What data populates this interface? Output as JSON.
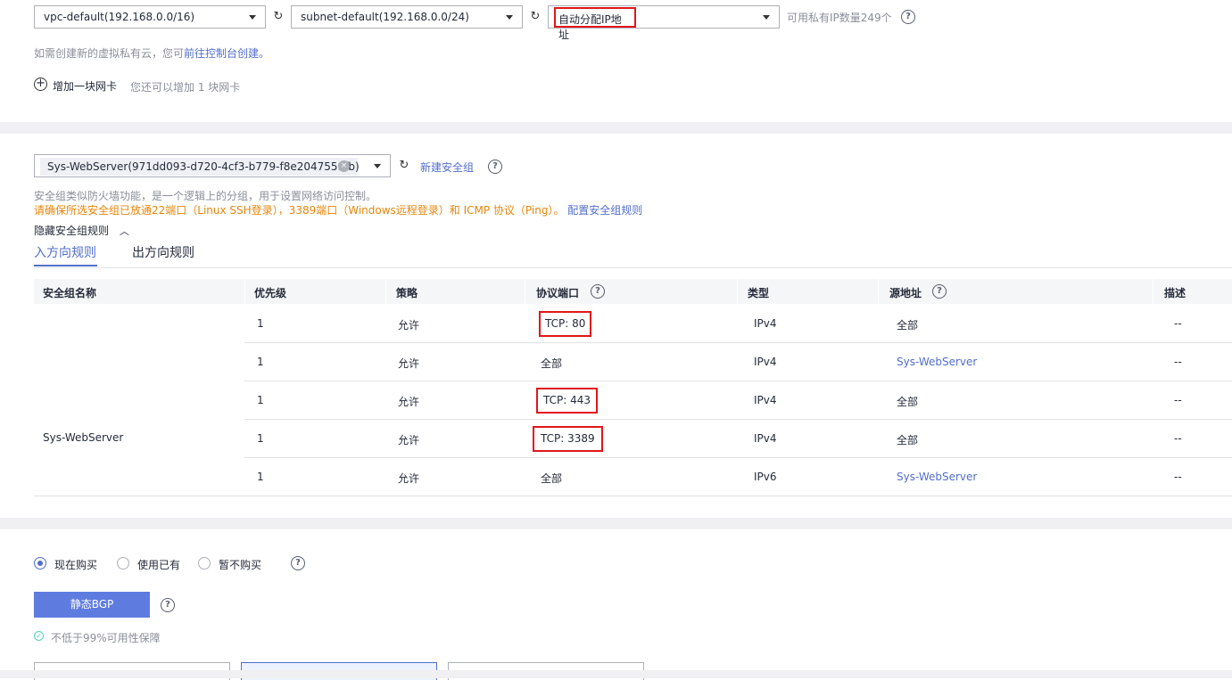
{
  "network": {
    "vpc_select": "vpc-default(192.168.0.0/16)",
    "subnet_select": "subnet-default(192.168.0.0/24)",
    "ip_select": "自动分配IP地址",
    "available_ip_text": "可用私有IP数量249个",
    "create_vpc_hint_prefix": "如需创建新的虚拟私有云，您可",
    "create_vpc_link": "前往控制台创建。",
    "add_nic_label": "增加一块网卡",
    "add_nic_hint": "您还可以增加 1 块网卡"
  },
  "security": {
    "group_tag": "Sys-WebServer(971dd093-d720-4cf3-b779-f8e2047559fb)",
    "new_group_link": "新建安全组",
    "desc": "安全组类似防火墙功能，是一个逻辑上的分组，用于设置网络访问控制。",
    "warning": "请确保所选安全组已放通22端口（Linux SSH登录），3389端口（Windows远程登录）和 ICMP 协议（Ping）。",
    "config_link": "配置安全组规则",
    "hide_rules": "隐藏安全组规则",
    "tabs": [
      "入方向规则",
      "出方向规则"
    ],
    "columns": [
      "安全组名称",
      "优先级",
      "策略",
      "协议端口",
      "类型",
      "源地址",
      "描述"
    ],
    "group_name": "Sys-WebServer",
    "rows": [
      {
        "priority": "1",
        "policy": "允许",
        "port": "TCP: 80",
        "type": "IPv4",
        "source": "全部",
        "desc": "--"
      },
      {
        "priority": "1",
        "policy": "允许",
        "port": "全部",
        "type": "IPv4",
        "source": "Sys-WebServer",
        "desc": "--"
      },
      {
        "priority": "1",
        "policy": "允许",
        "port": "TCP: 443",
        "type": "IPv4",
        "source": "全部",
        "desc": "--"
      },
      {
        "priority": "1",
        "policy": "允许",
        "port": "TCP: 3389",
        "type": "IPv4",
        "source": "全部",
        "desc": "--"
      },
      {
        "priority": "1",
        "policy": "允许",
        "port": "全部",
        "type": "IPv6",
        "source": "Sys-WebServer",
        "desc": "--"
      }
    ]
  },
  "eip": {
    "options": [
      "现在购买",
      "使用已有",
      "暂不购买"
    ],
    "selected": "现在购买",
    "line_button": "静态BGP",
    "sla_text": "不低于99%可用性保障"
  },
  "colors": {
    "accent": "#526ecc",
    "warning": "#e8850a",
    "highlight": "#e0161c"
  }
}
